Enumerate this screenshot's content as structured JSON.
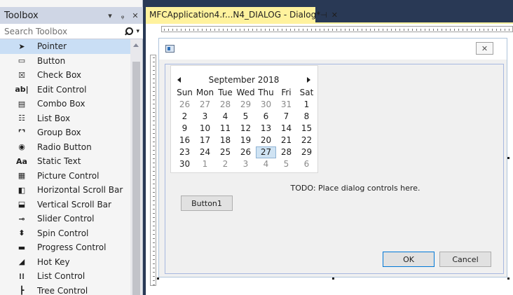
{
  "toolbox": {
    "title": "Toolbox",
    "dropdown_glyph": "▾",
    "pin_glyph": "ᵩ",
    "close_glyph": "✕",
    "search_placeholder": "Search Toolbox",
    "items": [
      {
        "label": "Pointer",
        "icon": "pointer-icon",
        "glyph": "➤",
        "selected": true
      },
      {
        "label": "Button",
        "icon": "button-icon",
        "glyph": "▭"
      },
      {
        "label": "Check Box",
        "icon": "checkbox-icon",
        "glyph": "☒"
      },
      {
        "label": "Edit Control",
        "icon": "edit-control-icon",
        "glyph": "ab|"
      },
      {
        "label": "Combo Box",
        "icon": "combo-box-icon",
        "glyph": "▤"
      },
      {
        "label": "List Box",
        "icon": "list-box-icon",
        "glyph": "☷"
      },
      {
        "label": "Group Box",
        "icon": "group-box-icon",
        "glyph": "⌜⌝"
      },
      {
        "label": "Radio Button",
        "icon": "radio-button-icon",
        "glyph": "◉"
      },
      {
        "label": "Static Text",
        "icon": "static-text-icon",
        "glyph": "Aa"
      },
      {
        "label": "Picture Control",
        "icon": "picture-control-icon",
        "glyph": "▦"
      },
      {
        "label": "Horizontal Scroll Bar",
        "icon": "hscroll-icon",
        "glyph": "◧"
      },
      {
        "label": "Vertical Scroll Bar",
        "icon": "vscroll-icon",
        "glyph": "⬓"
      },
      {
        "label": "Slider Control",
        "icon": "slider-icon",
        "glyph": "⊸"
      },
      {
        "label": "Spin Control",
        "icon": "spin-icon",
        "glyph": "⬍"
      },
      {
        "label": "Progress Control",
        "icon": "progress-icon",
        "glyph": "▬"
      },
      {
        "label": "Hot Key",
        "icon": "hot-key-icon",
        "glyph": "◢"
      },
      {
        "label": "List Control",
        "icon": "list-control-icon",
        "glyph": "⁞⁞"
      },
      {
        "label": "Tree Control",
        "icon": "tree-control-icon",
        "glyph": "┣"
      }
    ]
  },
  "document": {
    "tab_title": "MFCApplication4.r...N4_DIALOG - Dialog*",
    "tab_pin_glyph": "⊣",
    "tab_close_glyph": "✕"
  },
  "dialog": {
    "close_glyph": "✕",
    "calendar": {
      "title": "September 2018",
      "weekdays": [
        "Sun",
        "Mon",
        "Tue",
        "Wed",
        "Thu",
        "Fri",
        "Sat"
      ],
      "weeks": [
        [
          {
            "d": "26",
            "dim": true
          },
          {
            "d": "27",
            "dim": true
          },
          {
            "d": "28",
            "dim": true
          },
          {
            "d": "29",
            "dim": true
          },
          {
            "d": "30",
            "dim": true
          },
          {
            "d": "31",
            "dim": true
          },
          {
            "d": "1"
          }
        ],
        [
          {
            "d": "2"
          },
          {
            "d": "3"
          },
          {
            "d": "4"
          },
          {
            "d": "5"
          },
          {
            "d": "6"
          },
          {
            "d": "7"
          },
          {
            "d": "8"
          }
        ],
        [
          {
            "d": "9"
          },
          {
            "d": "10"
          },
          {
            "d": "11"
          },
          {
            "d": "12"
          },
          {
            "d": "13"
          },
          {
            "d": "14"
          },
          {
            "d": "15"
          }
        ],
        [
          {
            "d": "16"
          },
          {
            "d": "17"
          },
          {
            "d": "18"
          },
          {
            "d": "19"
          },
          {
            "d": "20"
          },
          {
            "d": "21"
          },
          {
            "d": "22"
          }
        ],
        [
          {
            "d": "23"
          },
          {
            "d": "24"
          },
          {
            "d": "25"
          },
          {
            "d": "26"
          },
          {
            "d": "27",
            "today": true
          },
          {
            "d": "28"
          },
          {
            "d": "29"
          }
        ],
        [
          {
            "d": "30"
          },
          {
            "d": "1",
            "dim": true
          },
          {
            "d": "2",
            "dim": true
          },
          {
            "d": "3",
            "dim": true
          },
          {
            "d": "4",
            "dim": true
          },
          {
            "d": "5",
            "dim": true
          },
          {
            "d": "6",
            "dim": true
          }
        ]
      ]
    },
    "todo_text": "TODO: Place dialog controls here.",
    "button1_label": "Button1",
    "ok_label": "OK",
    "cancel_label": "Cancel"
  }
}
